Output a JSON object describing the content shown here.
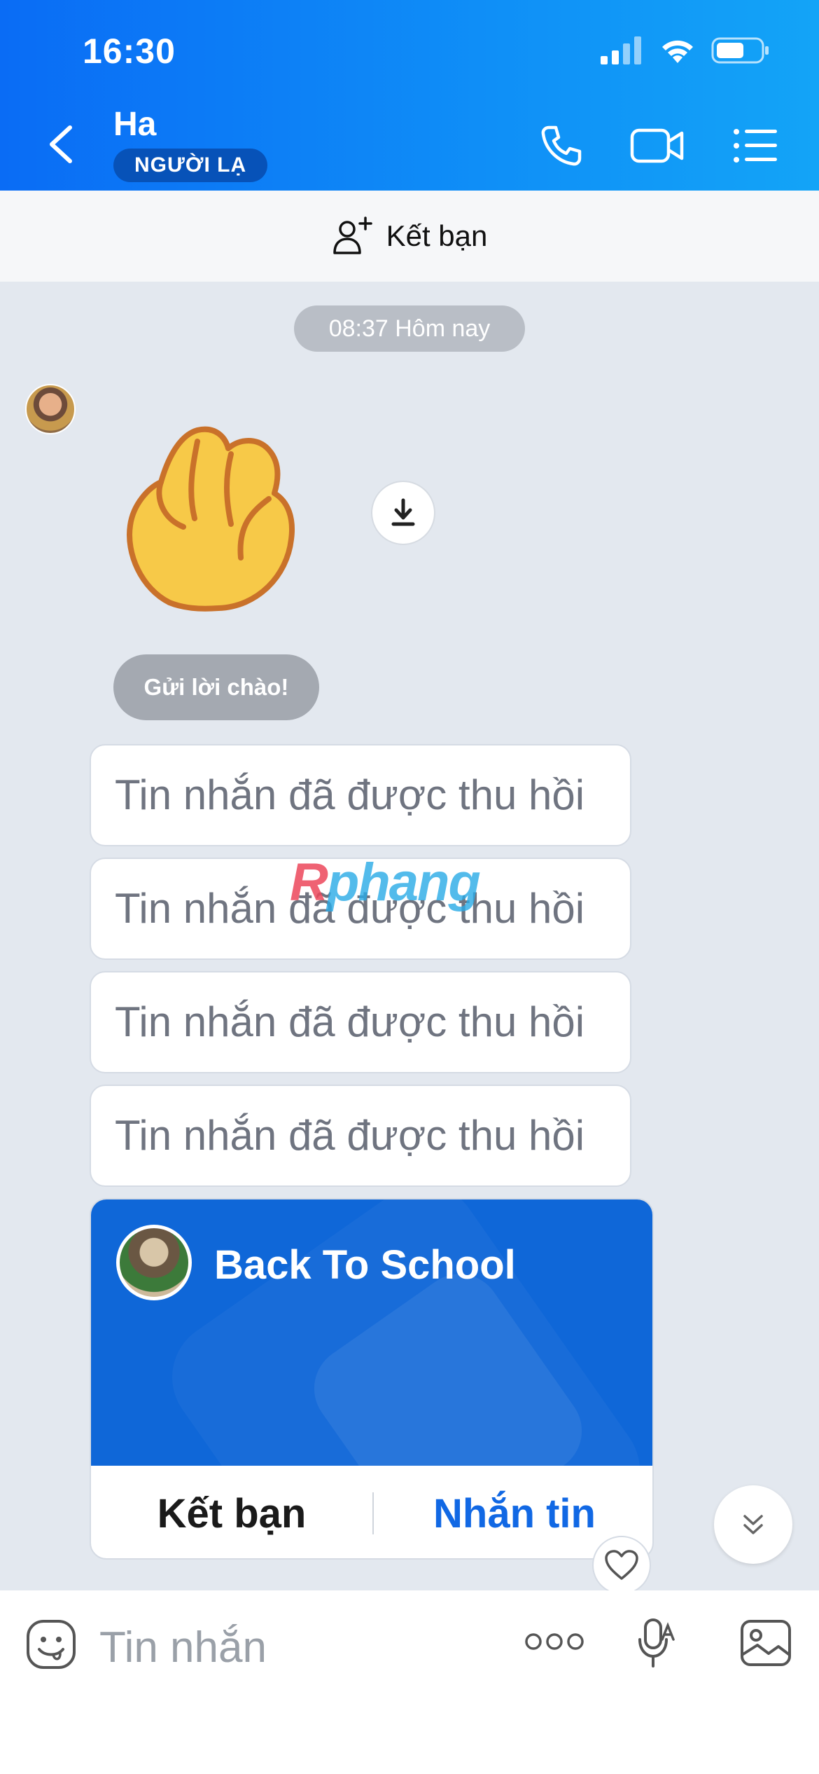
{
  "status_bar": {
    "time": "16:30"
  },
  "header": {
    "title": "Ha",
    "badge": "NGƯỜI LẠ"
  },
  "friend_bar": {
    "label": "Kết bạn"
  },
  "chat": {
    "timestamp": "08:37 Hôm nay",
    "greeting_label": "Gửi lời chào!",
    "recalled_messages": [
      "Tin nhắn đã được thu hồi",
      "Tin nhắn đã được thu hồi",
      "Tin nhắn đã được thu hồi",
      "Tin nhắn đã được thu hồi"
    ],
    "card": {
      "title": "Back To School",
      "add_friend_label": "Kết bạn",
      "message_label": "Nhắn tin"
    }
  },
  "watermark": {
    "part1": "R",
    "part2": "phang"
  },
  "input": {
    "placeholder": "Tin nhắn"
  },
  "colors": {
    "header_blue": "#0a6cf5",
    "link_blue": "#1168e4",
    "card_blue": "#0f67d8"
  }
}
